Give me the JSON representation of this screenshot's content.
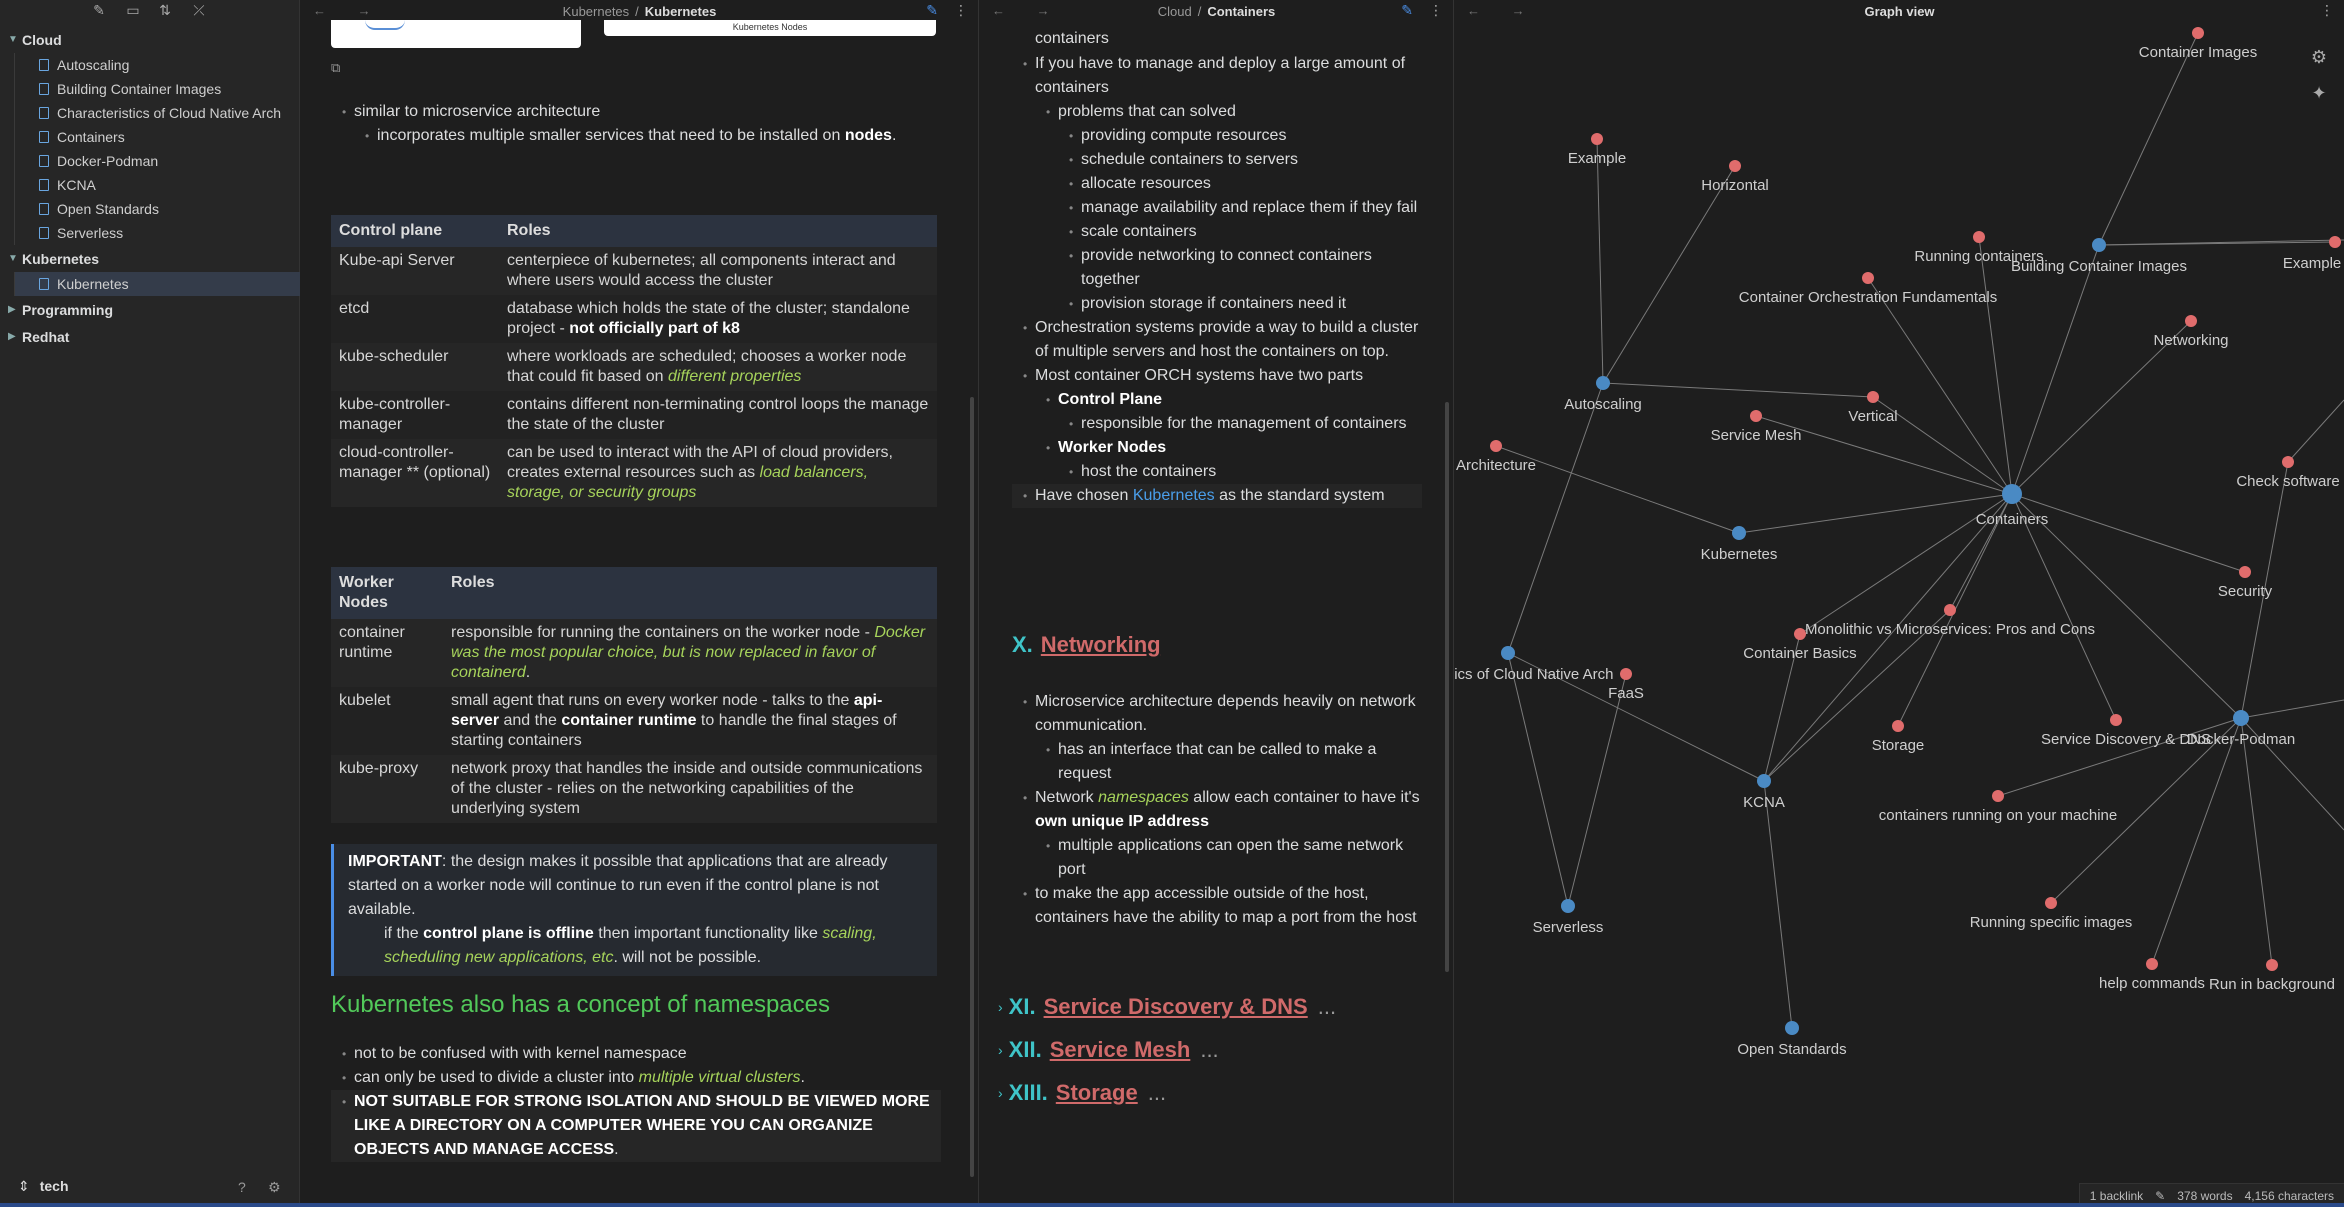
{
  "sidebar": {
    "folders": [
      {
        "name": "Cloud",
        "expanded": true,
        "files": [
          "Autoscaling",
          "Building Container Images",
          "Characteristics of Cloud Native Arch",
          "Containers",
          "Docker-Podman",
          "KCNA",
          "Open Standards",
          "Serverless"
        ]
      },
      {
        "name": "Kubernetes",
        "expanded": true,
        "files": [
          "Kubernetes"
        ]
      },
      {
        "name": "Programming",
        "expanded": false,
        "files": []
      },
      {
        "name": "Redhat",
        "expanded": false,
        "files": []
      }
    ],
    "active_file": "Kubernetes",
    "vault_name": "tech"
  },
  "pane1": {
    "crumb_parent": "Kubernetes",
    "crumb_current": "Kubernetes",
    "image_caption": "Kubernetes Nodes",
    "bullets_top": [
      "similar to microservice architecture",
      "incorporates multiple smaller services that need to be installed on",
      "nodes"
    ],
    "table1": {
      "headers": [
        "Control plane",
        "Roles"
      ],
      "rows": [
        [
          "Kube-api Server",
          "centerpiece of kubernetes; all components interact and where users would access the cluster"
        ],
        [
          "etcd",
          "database which holds the state of the cluster; standalone project - ",
          "not officially part of k8"
        ],
        [
          "kube-scheduler",
          "where workloads are scheduled; chooses a worker node that could fit based on ",
          "different properties"
        ],
        [
          "kube-controller-manager",
          "contains different non-terminating control loops the manage the state of the cluster"
        ],
        [
          "cloud-controller-manager ** (optional)",
          "can be used to interact with the API of cloud providers, creates external resources such as ",
          "load balancers, storage, or security groups"
        ]
      ]
    },
    "table2": {
      "headers": [
        "Worker Nodes",
        "Roles"
      ],
      "rows": [
        [
          "container runtime",
          "responsible for running the containers on the worker node - ",
          "Docker was the most popular choice, but is now replaced in favor of containerd",
          "."
        ],
        [
          "kubelet",
          "small agent that runs on every worker node - talks to the ",
          "api-server",
          " and the ",
          "container runtime",
          " to handle the final stages of starting containers"
        ],
        [
          "kube-proxy",
          "network proxy that handles the inside and outside communications of the cluster - relies on the networking capabilities of the underlying system"
        ]
      ]
    },
    "callout": {
      "label": "IMPORTANT",
      "text": ": the design makes it possible that applications that are already started on a worker node will continue to run even if the control plane is not available.",
      "sub_pre": "if the ",
      "sub_bold": "control plane is offline",
      "sub_mid": " then important functionality like ",
      "sub_it": "scaling, scheduling new applications, etc",
      "sub_post": ". will not be possible."
    },
    "ns_heading": "Kubernetes also has a concept of namespaces",
    "ns_bullets": [
      "not to be confused with with kernel namespace",
      "can only be used to divide a cluster into ",
      "multiple virtual clusters",
      "."
    ],
    "ns_caps": "NOT SUITABLE FOR STRONG ISOLATION AND SHOULD BE VIEWED MORE LIKE A DIRECTORY ON A COMPUTER WHERE YOU CAN ORGANIZE OBJECTS AND MANAGE ACCESS",
    "ns_caps_end": "."
  },
  "pane2": {
    "crumb_parent": "Cloud",
    "crumb_current": "Containers",
    "lines": {
      "l0": "containers",
      "l1": "If you have to manage and deploy a large amount of containers",
      "l2": "problems that can solved",
      "l3": [
        "providing compute resources",
        "schedule containers to servers",
        "allocate resources",
        "manage availability and replace them if they fail",
        "scale containers",
        "provide networking to connect containers together",
        "provision storage if containers need it"
      ],
      "l4": "Orchestration systems provide a way to build a cluster of multiple servers and host the containers on top.",
      "l5": "Most container ORCH systems have two parts",
      "cp": "Control Plane",
      "cp_sub": "responsible for the management of containers",
      "wn": "Worker Nodes",
      "wn_sub": "host the containers",
      "chosen_pre": "Have chosen ",
      "chosen_link": "Kubernetes",
      "chosen_post": " as the standard system"
    },
    "sec10": {
      "num": "X.",
      "title": "Networking"
    },
    "net": {
      "b1": "Microservice architecture depends heavily on network communication.",
      "b1a": "has an interface that can be called to make a request",
      "b2_pre": "Network ",
      "b2_it": "namespaces",
      "b2_mid": " allow each container to have it's ",
      "b2_bold": "own unique IP address",
      "b2a": "multiple applications can open the same network port",
      "b3": "to make the app accessible outside of the host, containers have the ability to map a port from the host"
    },
    "collapsed": [
      {
        "num": "XI.",
        "title": "Service Discovery & DNS",
        "more": "..."
      },
      {
        "num": "XII.",
        "title": "Service Mesh",
        "more": "..."
      },
      {
        "num": "XIII.",
        "title": "Storage",
        "more": "..."
      }
    ]
  },
  "graph": {
    "title": "Graph view",
    "colors": {
      "note": "#4a8ac4",
      "unresolved": "#e06c6c",
      "edge": "#7a7a7a",
      "label": "#cfcfcf"
    },
    "labels": [
      "Container Images",
      "Example",
      "Horizontal",
      "Running containers",
      "Building Container Images",
      "Example Bui",
      "Container Orchestration Fundamentals",
      "Networking",
      "Autoscaling",
      "Vertical",
      "Service Mesh",
      "Architecture",
      "Check software",
      "Containers",
      "Kubernetes",
      "Security",
      "Monolithic vs Microservices: Pros and Cons",
      "Container Basics",
      "stics of Cloud Native Arch",
      "FaaS",
      "Storage",
      "Service Discovery & DNS",
      "Docker-Podman",
      "KCNA",
      "containers running on your machine",
      "Serverless",
      "Running specific images",
      "help commands",
      "Run in background",
      "Open Standards"
    ]
  },
  "status": {
    "backlinks": "1 backlink",
    "words": "378 words",
    "chars": "4,156 characters"
  }
}
